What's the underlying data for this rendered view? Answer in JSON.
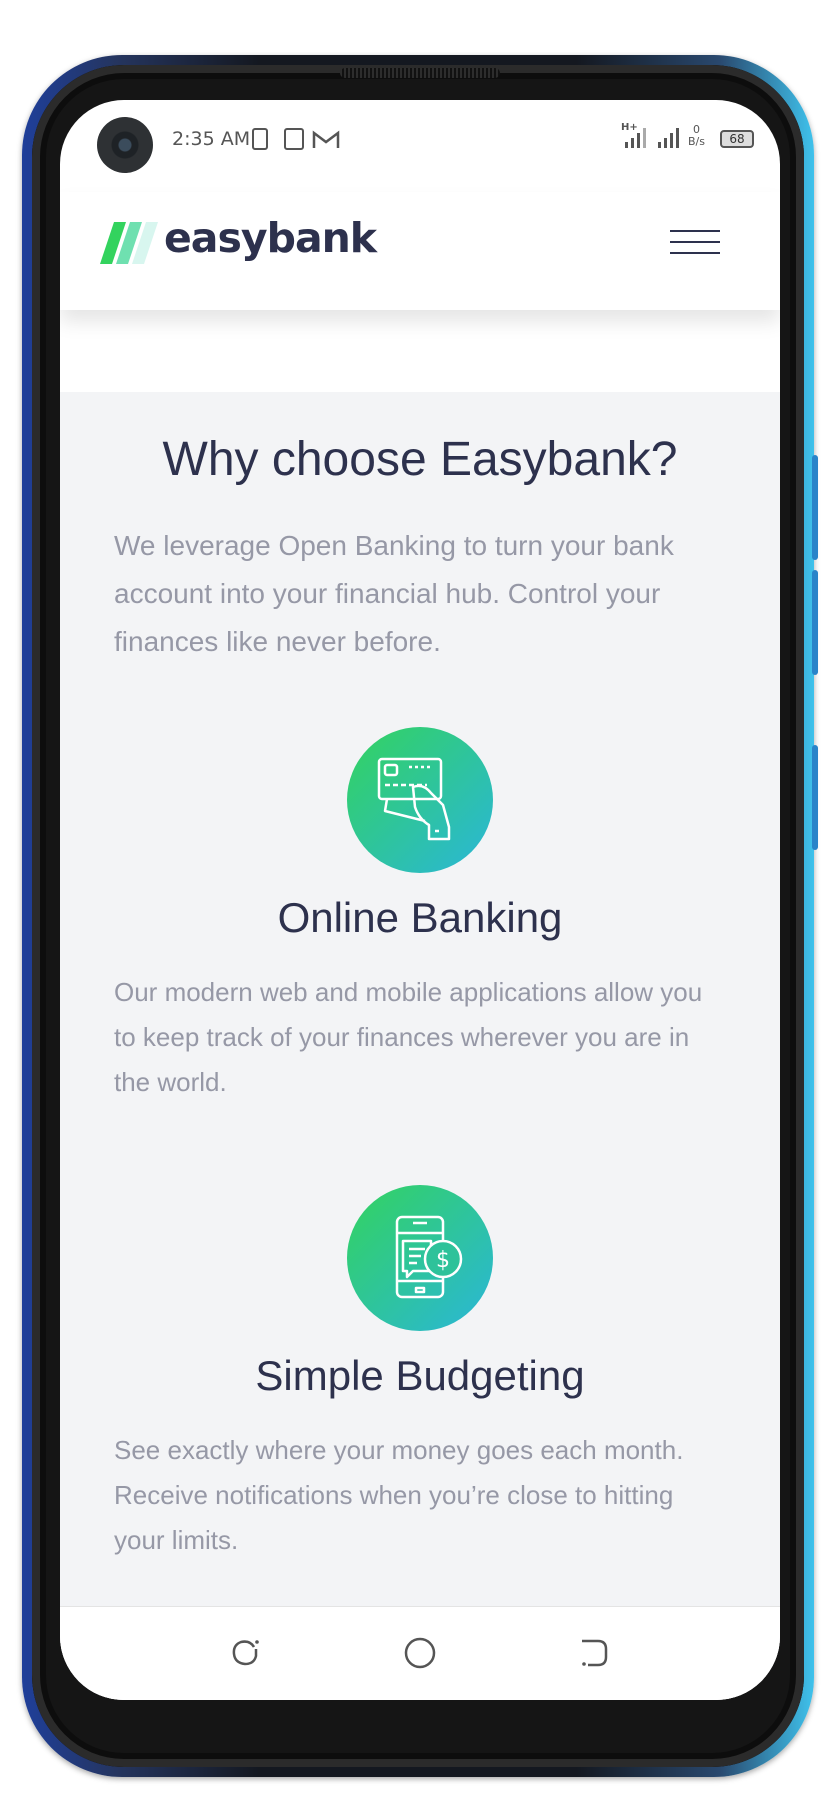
{
  "status_bar": {
    "time": "2:35 AM",
    "network_type": "H+",
    "speed_value": "0",
    "speed_unit": "B/s",
    "battery_level": "68"
  },
  "header": {
    "logo_text": "easybank"
  },
  "why": {
    "title": "Why choose Easybank?",
    "description": "We leverage Open Banking to turn your bank account into your financial hub. Control your finances like never before."
  },
  "features": [
    {
      "icon": "online-banking-icon",
      "title": "Online Banking",
      "description": "Our modern web and mobile applications allow you to keep track of your finances wherever you are in the world."
    },
    {
      "icon": "budgeting-icon",
      "title": "Simple Budgeting",
      "description": "See exactly where your money goes each month. Receive notifications when you’re close to hitting your limits."
    }
  ],
  "colors": {
    "brand_dark": "#2d314d",
    "gradient_start": "#33d35e",
    "gradient_end": "#2ab6d9",
    "text_muted": "#9698a6",
    "section_bg": "#f3f4f6"
  },
  "nav_bar": {
    "buttons": [
      "recent-apps-icon",
      "home-icon",
      "back-icon"
    ]
  }
}
